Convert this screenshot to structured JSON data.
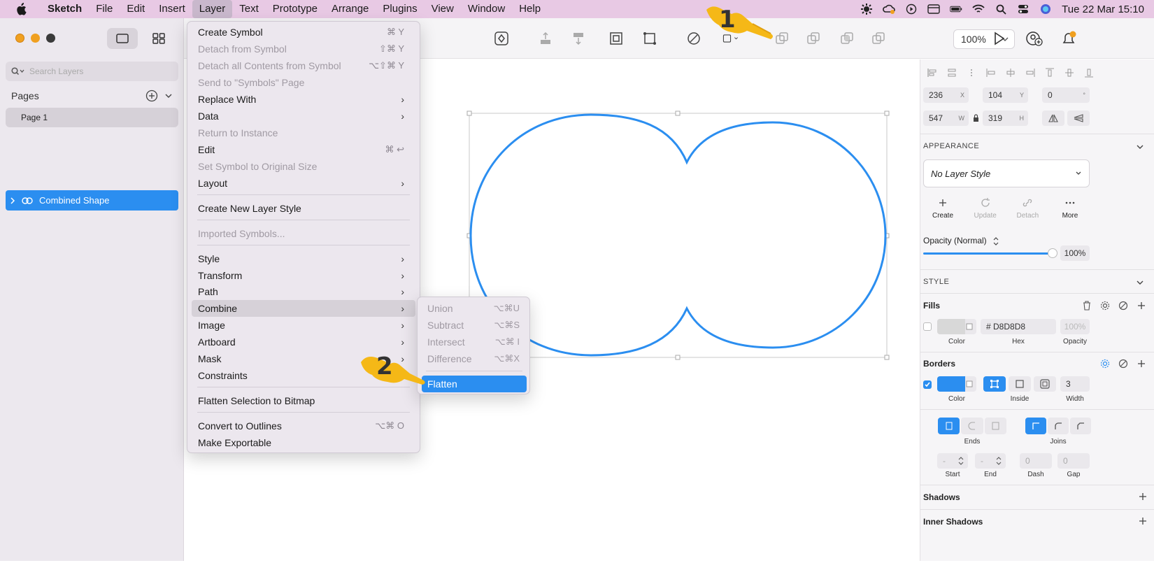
{
  "menubar": {
    "app": "Sketch",
    "items": [
      "File",
      "Edit",
      "Insert",
      "Layer",
      "Text",
      "Prototype",
      "Arrange",
      "Plugins",
      "View",
      "Window",
      "Help"
    ],
    "clock": "Tue 22 Mar  15:10"
  },
  "sidebar": {
    "search_placeholder": "Search Layers",
    "pages_label": "Pages",
    "page_item": "Page 1",
    "layer_item": "Combined Shape"
  },
  "toolbar": {
    "zoom": "100%"
  },
  "layer_menu": {
    "items": [
      {
        "label": "Create Symbol",
        "shortcut": "⌘ Y"
      },
      {
        "label": "Detach from Symbol",
        "shortcut": "⇧⌘ Y"
      },
      {
        "label": "Detach all Contents from Symbol",
        "shortcut": "⌥⇧⌘ Y"
      },
      {
        "label": "Send to \"Symbols\" Page",
        "shortcut": ""
      },
      {
        "label": "Replace With",
        "shortcut": "›"
      },
      {
        "label": "Data",
        "shortcut": "›"
      },
      {
        "label": "Return to Instance",
        "shortcut": ""
      },
      {
        "label": "Edit",
        "shortcut": "⌘ ↩"
      },
      {
        "label": "Set Symbol to Original Size",
        "shortcut": ""
      },
      {
        "label": "Layout",
        "shortcut": "›"
      },
      {
        "label": "Create New Layer Style",
        "shortcut": ""
      },
      {
        "label": "Imported Symbols...",
        "shortcut": ""
      },
      {
        "label": "Style",
        "shortcut": "›"
      },
      {
        "label": "Transform",
        "shortcut": "›"
      },
      {
        "label": "Path",
        "shortcut": "›"
      },
      {
        "label": "Combine",
        "shortcut": "›"
      },
      {
        "label": "Image",
        "shortcut": "›"
      },
      {
        "label": "Artboard",
        "shortcut": "›"
      },
      {
        "label": "Mask",
        "shortcut": "›"
      },
      {
        "label": "Constraints",
        "shortcut": "›"
      },
      {
        "label": "Flatten Selection to Bitmap",
        "shortcut": ""
      },
      {
        "label": "Convert to Outlines",
        "shortcut": "⌥⌘ O"
      },
      {
        "label": "Make Exportable",
        "shortcut": ""
      }
    ]
  },
  "combine_submenu": {
    "items": [
      {
        "label": "Union",
        "shortcut": "⌥⌘U"
      },
      {
        "label": "Subtract",
        "shortcut": "⌥⌘S"
      },
      {
        "label": "Intersect",
        "shortcut": "⌥⌘ I"
      },
      {
        "label": "Difference",
        "shortcut": "⌥⌘X"
      },
      {
        "label": "Flatten",
        "shortcut": ""
      }
    ]
  },
  "inspector": {
    "x": "236",
    "x_unit": "X",
    "y": "104",
    "y_unit": "Y",
    "rotation": "0",
    "rotation_unit": "°",
    "w": "547",
    "w_unit": "W",
    "h": "319",
    "h_unit": "H",
    "appearance_label": "APPEARANCE",
    "layer_style": "No Layer Style",
    "actions": [
      "Create",
      "Update",
      "Detach",
      "More"
    ],
    "opacity_label": "Opacity (Normal)",
    "opacity_value": "100%",
    "style_label": "STYLE",
    "fills_label": "Fills",
    "fill_hex": "# D8D8D8",
    "fill_opacity": "100%",
    "fill_cols": [
      "Color",
      "Hex",
      "Opacity"
    ],
    "borders_label": "Borders",
    "border_width": "3",
    "border_cols": [
      "Color",
      "Inside",
      "Width"
    ],
    "ends_label": "Ends",
    "joins_label": "Joins",
    "start_val": "-",
    "end_val": "-",
    "dash_val": "0",
    "gap_val": "0",
    "arrow_cols": [
      "Start",
      "End",
      "Dash",
      "Gap"
    ],
    "shadows_label": "Shadows",
    "inner_shadows_label": "Inner Shadows"
  },
  "callouts": [
    "1",
    "2"
  ],
  "colors": {
    "accent": "#2b8ef0",
    "menubar": "#e8c9e4",
    "shape_stroke": "#2b8ef0",
    "callout_hand": "#f5b817"
  }
}
